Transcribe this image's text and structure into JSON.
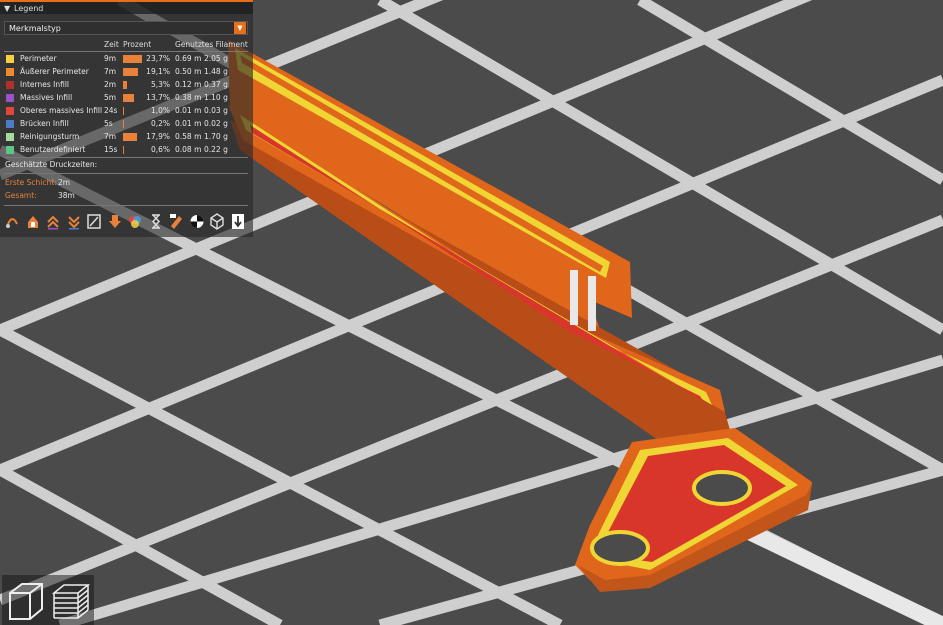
{
  "legend": {
    "title": "Legend",
    "view_type": "Merkmalstyp",
    "columns": {
      "time": "Zeit",
      "percent": "Prozent",
      "used": "Genutztes Filament"
    },
    "rows": [
      {
        "name": "Perimeter",
        "time": "9m",
        "percent": "23,7%",
        "pct": 23.7,
        "meters": "0.69 m",
        "grams": "2.05 g",
        "color": "#f5d142"
      },
      {
        "name": "Äußerer Perimeter",
        "time": "7m",
        "percent": "19,1%",
        "pct": 19.1,
        "meters": "0.50 m",
        "grams": "1.48 g",
        "color": "#f08a2a"
      },
      {
        "name": "Internes Infill",
        "time": "2m",
        "percent": "5,3%",
        "pct": 5.3,
        "meters": "0.12 m",
        "grams": "0.37 g",
        "color": "#b03030"
      },
      {
        "name": "Massives Infill",
        "time": "5m",
        "percent": "13,7%",
        "pct": 13.7,
        "meters": "0.38 m",
        "grams": "1.10 g",
        "color": "#9a52c6"
      },
      {
        "name": "Oberes massives Infill",
        "time": "24s",
        "percent": "1,0%",
        "pct": 1.0,
        "meters": "0.01 m",
        "grams": "0.03 g",
        "color": "#e0453c"
      },
      {
        "name": "Brücken Infill",
        "time": "5s",
        "percent": "0,2%",
        "pct": 0.2,
        "meters": "0.01 m",
        "grams": "0.02 g",
        "color": "#4f7cc8"
      },
      {
        "name": "Reinigungsturm",
        "time": "7m",
        "percent": "17,9%",
        "pct": 17.9,
        "meters": "0.58 m",
        "grams": "1.70 g",
        "color": "#a4dca0"
      },
      {
        "name": "Benutzerdefiniert",
        "time": "15s",
        "percent": "0,6%",
        "pct": 0.6,
        "meters": "0.08 m",
        "grams": "0.22 g",
        "color": "#5ec48a"
      }
    ],
    "estimated_label": "Geschätzte Druckzeiten:",
    "first_layer_label": "Erste Schicht:",
    "first_layer_value": "2m",
    "total_label": "Gesamt:",
    "total_value": "38m"
  },
  "toolbar_icons": [
    "travel-icon",
    "wipe-icon",
    "retractions-icon",
    "deretractions-icon",
    "seams-icon",
    "tool-changes-icon",
    "color-changes-icon",
    "pause-icon",
    "custom-gcode-icon",
    "center-of-gravity-icon",
    "shells-icon",
    "tool-marker-icon"
  ],
  "view_buttons": [
    "3d-view-icon",
    "layers-view-icon"
  ],
  "colors": {
    "accent": "#e86e1a",
    "print_orange": "#e0661c",
    "perimeter_yellow": "#efd634",
    "infill_red": "#d8362a",
    "bed_grey": "#4a4a4a"
  }
}
